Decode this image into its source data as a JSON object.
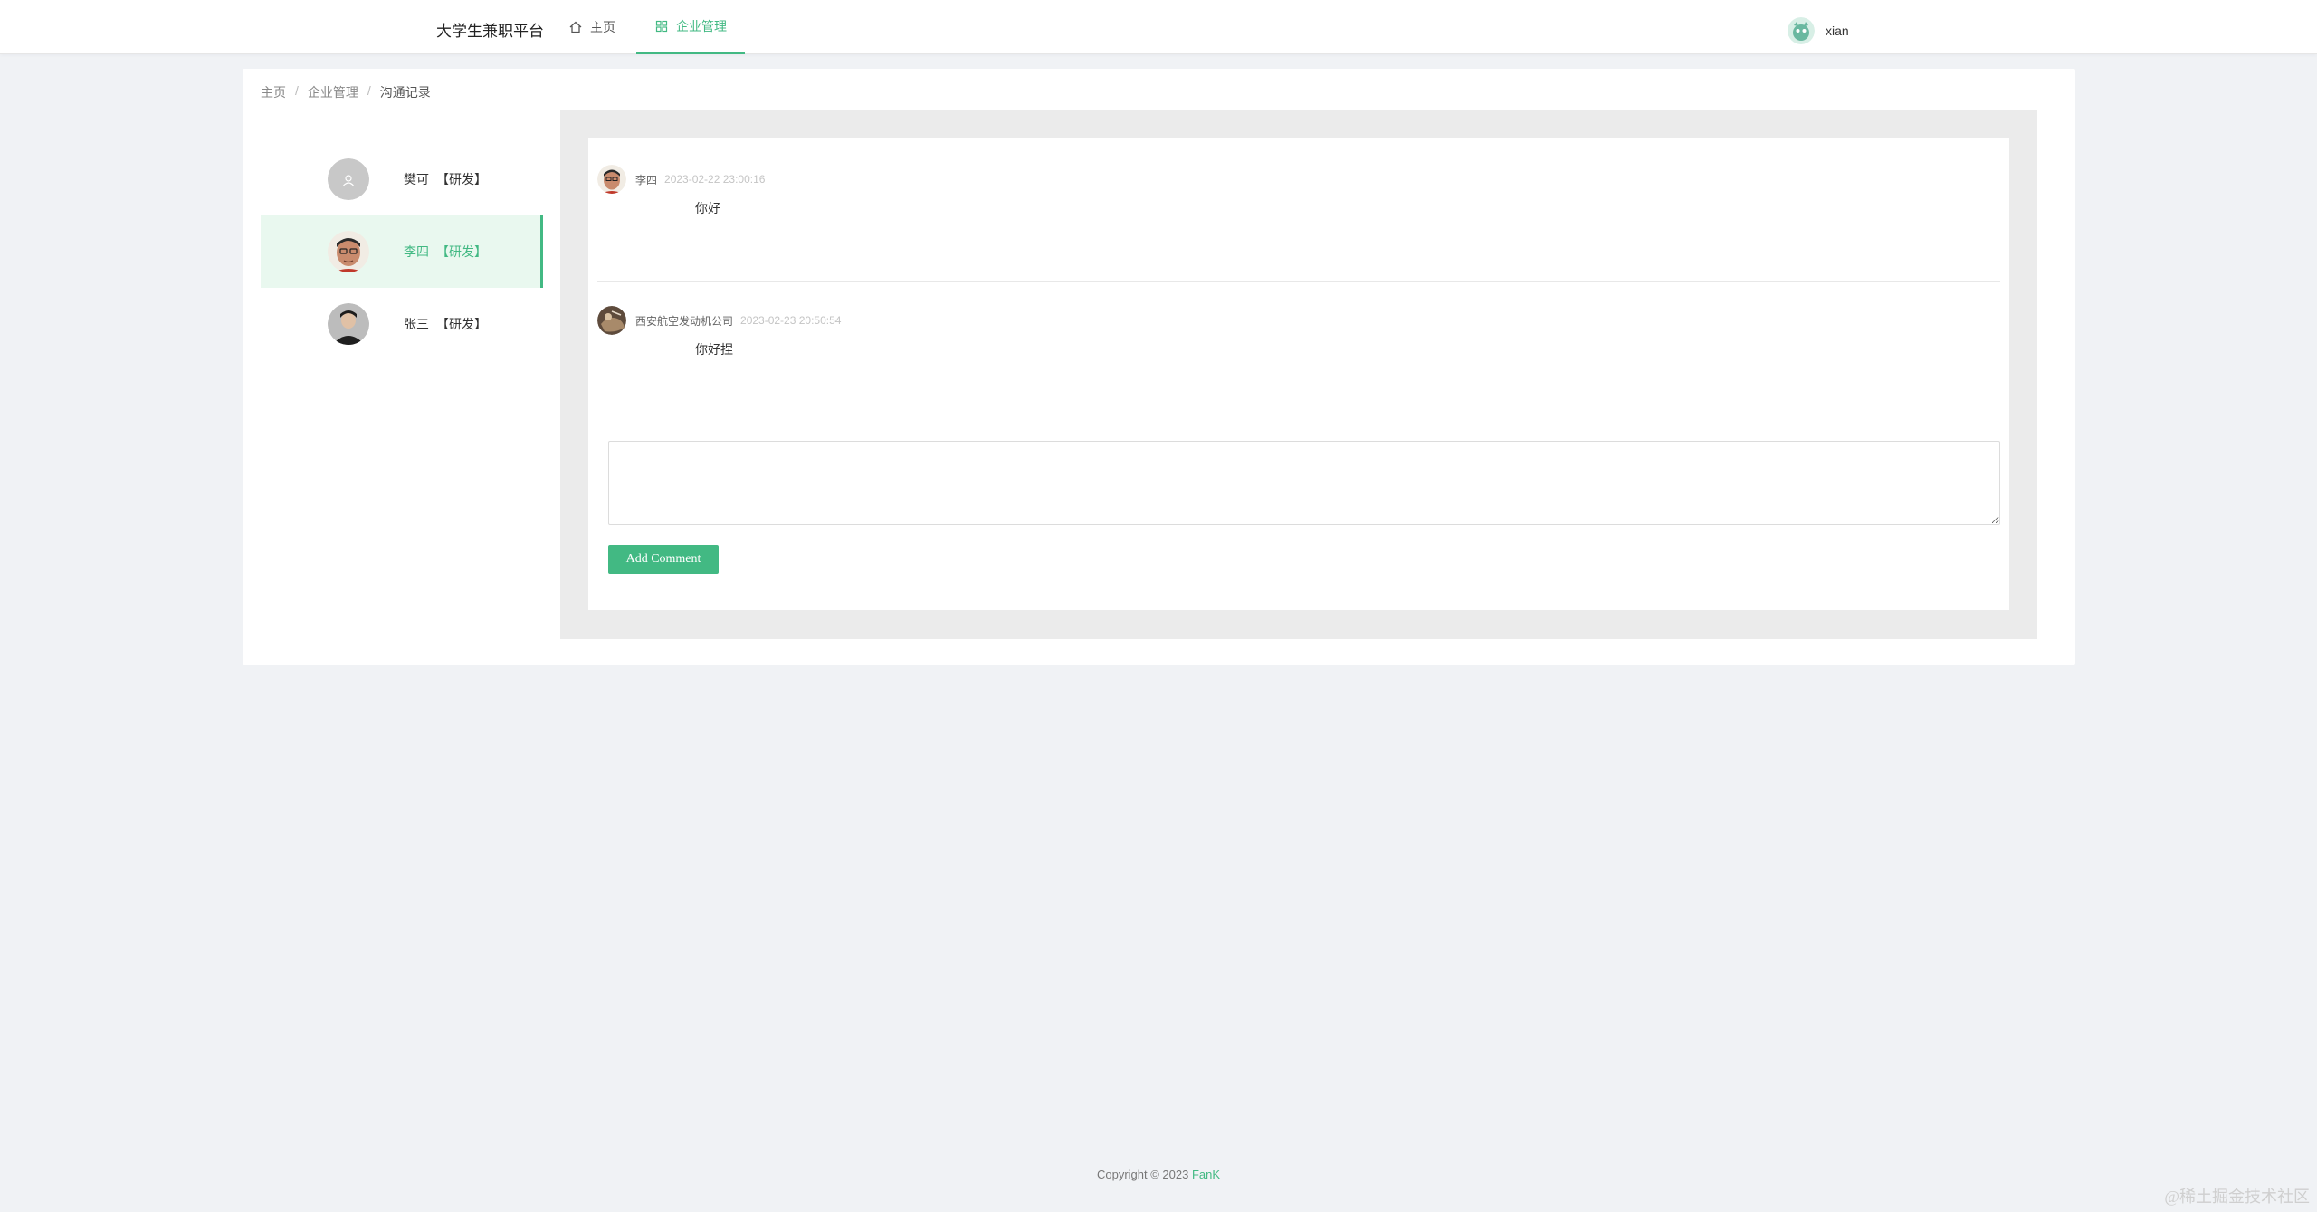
{
  "header": {
    "brand": "大学生兼职平台",
    "nav": [
      {
        "label": "主页",
        "icon": "home-icon"
      },
      {
        "label": "企业管理",
        "icon": "grid-icon",
        "active": true
      }
    ],
    "user": {
      "name": "xian"
    }
  },
  "breadcrumb": [
    "主页",
    "企业管理",
    "沟通记录"
  ],
  "contacts": [
    {
      "name": "樊可",
      "tag": "【研发】"
    },
    {
      "name": "李四",
      "tag": "【研发】",
      "active": true
    },
    {
      "name": "张三",
      "tag": "【研发】"
    }
  ],
  "messages": [
    {
      "author": "李四",
      "time": "2023-02-22 23:00:16",
      "text": "你好"
    },
    {
      "author": "西安航空发动机公司",
      "time": "2023-02-23 20:50:54",
      "text": "你好捏"
    }
  ],
  "comment": {
    "value": "",
    "button_label": "Add Comment"
  },
  "footer": {
    "copyright": "Copyright © 2023",
    "author": "FanK"
  },
  "watermark": "@稀土掘金技术社区",
  "colors": {
    "accent": "#42b983",
    "active_bg": "#e9f8ef",
    "page_bg": "#f0f2f5"
  }
}
